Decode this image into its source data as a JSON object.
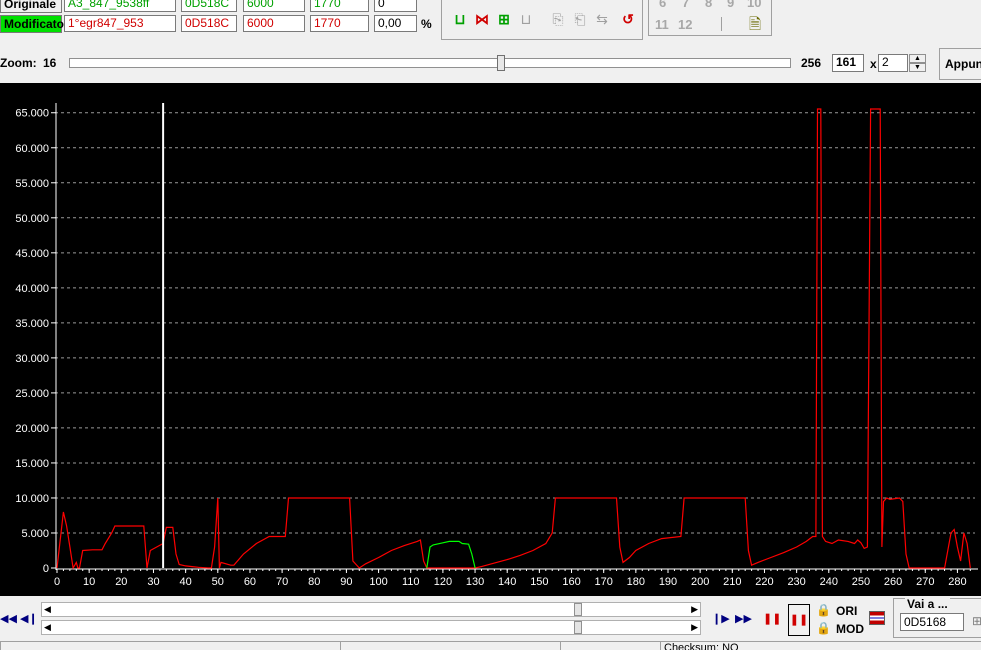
{
  "info_table": {
    "original": {
      "label": "Originale",
      "name": "A3_847_9538ff",
      "address": "0D518C",
      "val1": "6000",
      "val2": "1770",
      "val3": "0"
    },
    "modified": {
      "label": "Modificato",
      "name": "1°egr847_953",
      "address": "0D518C",
      "val1": "6000",
      "val2": "1770",
      "val3": "0,00",
      "unit": "%"
    }
  },
  "map_numbers": [
    "6",
    "7",
    "8",
    "9",
    "10",
    "11",
    "12"
  ],
  "zoom_bar": {
    "label": "Zoom:",
    "min": "16",
    "max": "256",
    "value": "161",
    "times": "x",
    "multiplier": "2",
    "slider_fraction": 0.6,
    "appunti_label": "Appun"
  },
  "chart_data": {
    "type": "line",
    "y_ticks": [
      "65.000",
      "60.000",
      "55.000",
      "50.000",
      "45.000",
      "40.000",
      "35.000",
      "30.000",
      "25.000",
      "20.000",
      "15.000",
      "10.000",
      "5.000",
      "0"
    ],
    "x_ticks": [
      "0",
      "10",
      "20",
      "30",
      "40",
      "50",
      "60",
      "70",
      "80",
      "90",
      "100",
      "110",
      "120",
      "130",
      "140",
      "150",
      "160",
      "170",
      "180",
      "190",
      "200",
      "210",
      "220",
      "230",
      "240",
      "250",
      "260",
      "270",
      "280"
    ],
    "xlim": [
      0,
      285
    ],
    "ylim": [
      0,
      65535
    ],
    "cursor_x": 33,
    "grid": true,
    "series": [
      {
        "color": "#ff0000",
        "points": [
          [
            0,
            0
          ],
          [
            1,
            4000
          ],
          [
            2,
            8000
          ],
          [
            3,
            6000
          ],
          [
            4,
            3000
          ],
          [
            5,
            0
          ],
          [
            6,
            800
          ],
          [
            6.5,
            0
          ],
          [
            7,
            0
          ],
          [
            8,
            2500
          ],
          [
            11,
            2600
          ],
          [
            14,
            2600
          ],
          [
            15,
            3500
          ],
          [
            17,
            5000
          ],
          [
            18,
            6000
          ],
          [
            26,
            6000
          ],
          [
            27,
            6000
          ],
          [
            28,
            0
          ],
          [
            29,
            2500
          ],
          [
            31,
            3000
          ],
          [
            33,
            3500
          ],
          [
            34,
            5800
          ],
          [
            36,
            5800
          ],
          [
            37,
            2000
          ],
          [
            38,
            500
          ],
          [
            40,
            300
          ],
          [
            42,
            200
          ],
          [
            44,
            100
          ],
          [
            47,
            0
          ],
          [
            48,
            0
          ],
          [
            49,
            3000
          ],
          [
            50,
            10000
          ],
          [
            50.5,
            0
          ],
          [
            51,
            800
          ],
          [
            54,
            400
          ],
          [
            55,
            400
          ],
          [
            58,
            2000
          ],
          [
            62,
            3500
          ],
          [
            66,
            4500
          ],
          [
            70,
            4500
          ],
          [
            71,
            4500
          ],
          [
            72,
            10000
          ],
          [
            91,
            10000
          ],
          [
            92,
            1000
          ],
          [
            94,
            0
          ],
          [
            96,
            600
          ],
          [
            100,
            1500
          ],
          [
            104,
            2500
          ],
          [
            108,
            3200
          ],
          [
            112,
            3800
          ],
          [
            113,
            4000
          ],
          [
            114,
            1000
          ],
          [
            115,
            0
          ],
          [
            130,
            0
          ],
          [
            132,
            200
          ],
          [
            136,
            700
          ],
          [
            140,
            1200
          ],
          [
            144,
            1800
          ],
          [
            148,
            2500
          ],
          [
            152,
            3500
          ],
          [
            154,
            5000
          ],
          [
            155,
            10000
          ],
          [
            174,
            10000
          ],
          [
            175,
            3000
          ],
          [
            176,
            800
          ],
          [
            178,
            1500
          ],
          [
            180,
            2500
          ],
          [
            184,
            3500
          ],
          [
            188,
            4200
          ],
          [
            194,
            4500
          ],
          [
            195,
            10000
          ],
          [
            214,
            10000
          ],
          [
            215,
            2500
          ],
          [
            216,
            400
          ],
          [
            218,
            800
          ],
          [
            222,
            1500
          ],
          [
            226,
            2200
          ],
          [
            230,
            3000
          ],
          [
            233,
            3800
          ],
          [
            235,
            4500
          ],
          [
            236,
            4500
          ],
          [
            236.5,
            65535
          ],
          [
            237.5,
            65535
          ],
          [
            238,
            4500
          ],
          [
            239,
            3800
          ],
          [
            241,
            3500
          ],
          [
            243,
            4000
          ],
          [
            246,
            3800
          ],
          [
            248,
            3500
          ],
          [
            249,
            4000
          ],
          [
            250,
            3600
          ],
          [
            251,
            2800
          ],
          [
            252,
            3000
          ],
          [
            253,
            65535
          ],
          [
            256,
            65535
          ],
          [
            256.5,
            3000
          ],
          [
            257,
            9500
          ],
          [
            258,
            10000
          ],
          [
            259,
            9800
          ],
          [
            262,
            10000
          ],
          [
            263,
            9500
          ],
          [
            264,
            2000
          ],
          [
            265,
            0
          ],
          [
            276,
            0
          ],
          [
            277,
            2500
          ],
          [
            278,
            5000
          ],
          [
            279,
            5500
          ],
          [
            280,
            3000
          ],
          [
            281,
            1000
          ],
          [
            282,
            5000
          ],
          [
            283,
            3500
          ],
          [
            284,
            0
          ]
        ]
      },
      {
        "color": "#00ff00",
        "points": [
          [
            115,
            0
          ],
          [
            116,
            3000
          ],
          [
            117,
            3300
          ],
          [
            120,
            3600
          ],
          [
            122,
            3800
          ],
          [
            125,
            3800
          ],
          [
            126,
            3500
          ],
          [
            128,
            3400
          ],
          [
            129,
            2000
          ],
          [
            130,
            0
          ]
        ]
      }
    ]
  },
  "bottom": {
    "ori_label": "ORI",
    "mod_label": "MOD",
    "goto_label": "Vai a ...",
    "goto_value": "0D5168",
    "status_checksum": "Checksum: NO"
  }
}
